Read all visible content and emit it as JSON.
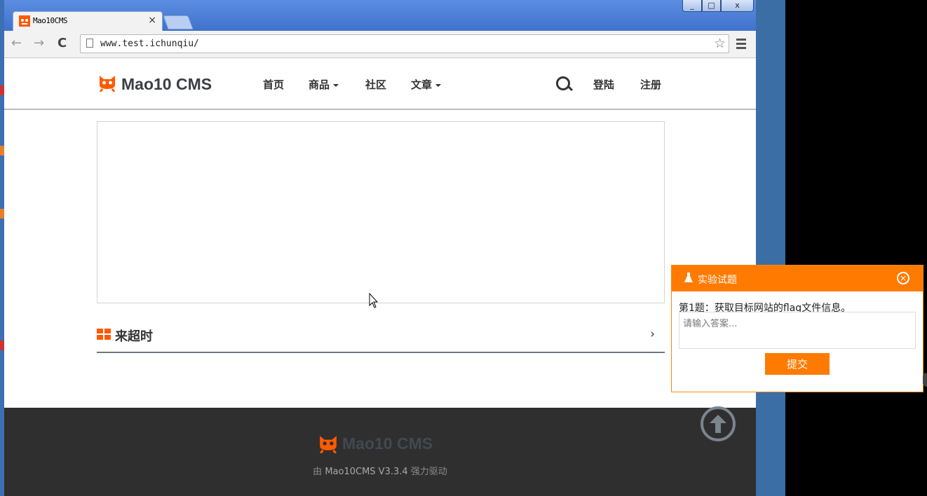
{
  "browser": {
    "tab_title": "Mao10CMS",
    "tab_close": "×",
    "url": "www.test.ichunqiu/",
    "star": "☆"
  },
  "window_controls": {
    "minimize": "_",
    "maximize": "□",
    "close": "x"
  },
  "nav_buttons": {
    "back": "←",
    "forward": "→",
    "reload": "C"
  },
  "site": {
    "logo_text": "Mao10 CMS",
    "nav": [
      {
        "label": "首页"
      },
      {
        "label": "商品"
      },
      {
        "label": "社区"
      },
      {
        "label": "文章"
      }
    ],
    "login": "登陆",
    "register": "注册"
  },
  "section": {
    "title": "来超时",
    "arrow": "›"
  },
  "footer": {
    "logo_text": "Mao10 CMS",
    "powered_prefix": "由",
    "powered_product": "Mao10CMS V3.3.4",
    "powered_suffix": "强力驱动"
  },
  "lab": {
    "title": "实验试题",
    "question": "第1题：获取目标网站的flag文件信息。",
    "placeholder": "请输入答案...",
    "submit": "提交",
    "close": "×"
  },
  "colors": {
    "accent": "#ff7a00",
    "logo_orange": "#ff5a00",
    "footer_bg": "#2f2f2f"
  },
  "icons": [
    "search-icon",
    "star-icon",
    "menu-icon",
    "flask-icon",
    "close-circle-icon",
    "arrow-up-circle-icon",
    "grid-icon",
    "cat-logo-icon"
  ]
}
